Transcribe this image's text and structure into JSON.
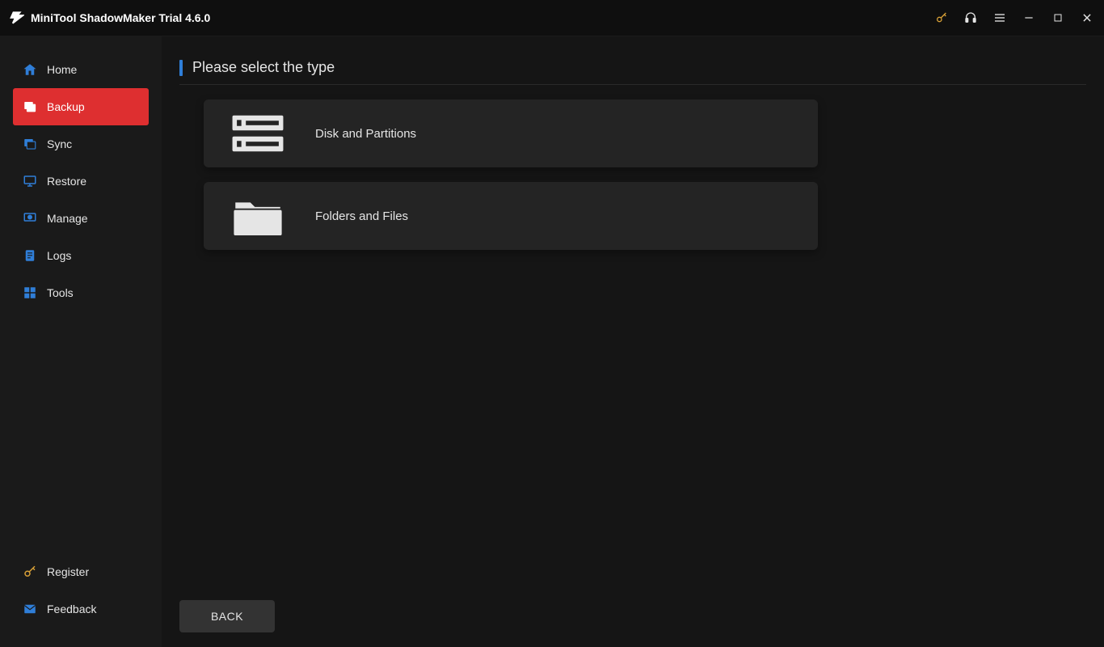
{
  "title": "MiniTool ShadowMaker Trial 4.6.0",
  "sidebar": {
    "items": [
      {
        "label": "Home"
      },
      {
        "label": "Backup"
      },
      {
        "label": "Sync"
      },
      {
        "label": "Restore"
      },
      {
        "label": "Manage"
      },
      {
        "label": "Logs"
      },
      {
        "label": "Tools"
      }
    ],
    "bottom": {
      "register": "Register",
      "feedback": "Feedback"
    }
  },
  "main": {
    "heading": "Please select the type",
    "options": [
      {
        "label": "Disk and Partitions"
      },
      {
        "label": "Folders and Files"
      }
    ],
    "back": "BACK"
  }
}
